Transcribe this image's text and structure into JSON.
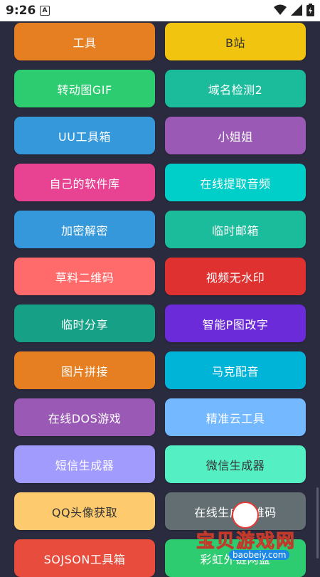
{
  "status_bar": {
    "time": "9:26",
    "notification_icon": "a-icon"
  },
  "buttons": [
    {
      "label": "工具",
      "color": "#e67e22",
      "text_dark": false
    },
    {
      "label": "B站",
      "color": "#f1c40f",
      "text_dark": true
    },
    {
      "label": "转动图GIF",
      "color": "#2ecc71",
      "text_dark": false
    },
    {
      "label": "域名检测2",
      "color": "#1abc9c",
      "text_dark": false
    },
    {
      "label": "UU工具箱",
      "color": "#3498db",
      "text_dark": false
    },
    {
      "label": "小姐姐",
      "color": "#9b59b6",
      "text_dark": false
    },
    {
      "label": "自己的软件库",
      "color": "#e84393",
      "text_dark": false
    },
    {
      "label": "在线提取音频",
      "color": "#00cec9",
      "text_dark": false
    },
    {
      "label": "加密解密",
      "color": "#3498db",
      "text_dark": false
    },
    {
      "label": "临时邮箱",
      "color": "#1abc9c",
      "text_dark": false
    },
    {
      "label": "草料二维码",
      "color": "#ff6b6b",
      "text_dark": false
    },
    {
      "label": "视频无水印",
      "color": "#e03131",
      "text_dark": false
    },
    {
      "label": "临时分享",
      "color": "#16a085",
      "text_dark": false
    },
    {
      "label": "智能P图改字",
      "color": "#6c2bd9",
      "text_dark": false
    },
    {
      "label": "图片拼接",
      "color": "#e67e22",
      "text_dark": false
    },
    {
      "label": "马克配音",
      "color": "#00b4d8",
      "text_dark": false
    },
    {
      "label": "在线DOS游戏",
      "color": "#9b59b6",
      "text_dark": false
    },
    {
      "label": "精准云工具",
      "color": "#74b9ff",
      "text_dark": false
    },
    {
      "label": "短信生成器",
      "color": "#a29bfe",
      "text_dark": false
    },
    {
      "label": "微信生成器",
      "color": "#55efc4",
      "text_dark": true
    },
    {
      "label": "QQ头像获取",
      "color": "#fdcb6e",
      "text_dark": true
    },
    {
      "label": "在线生成二维码",
      "color": "#636e72",
      "text_dark": false
    },
    {
      "label": "SOJSON工具箱",
      "color": "#e74c3c",
      "text_dark": false
    },
    {
      "label": "彩虹外链网盘",
      "color": "#2ecc71",
      "text_dark": false
    }
  ],
  "watermark": {
    "title": "宝贝游戏网",
    "url": "baobeiy.com"
  }
}
